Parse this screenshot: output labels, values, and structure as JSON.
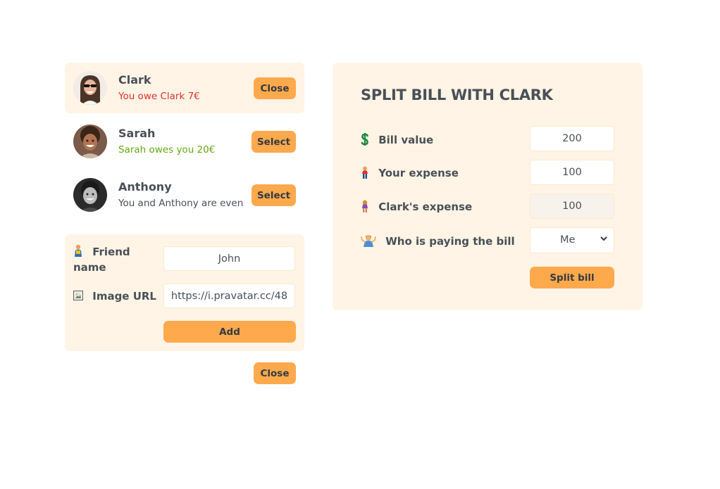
{
  "friends": [
    {
      "name": "Clark",
      "status": "You owe Clark 7€",
      "button": "Close",
      "selected": true
    },
    {
      "name": "Sarah",
      "status": "Sarah owes you 20€",
      "button": "Select",
      "selected": false
    },
    {
      "name": "Anthony",
      "status": "You and Anthony are even",
      "button": "Select",
      "selected": false
    }
  ],
  "add_form": {
    "name_label": "Friend name",
    "name_value": "John",
    "image_label": "Image URL",
    "image_value": "https://i.pravatar.cc/48",
    "add_label": "Add",
    "close_label": "Close"
  },
  "split": {
    "title": "SPLIT BILL WITH CLARK",
    "bill_label": "Bill value",
    "bill_value": "200",
    "expense_label": "Your expense",
    "expense_value": "100",
    "friend_expense_label": "Clark's expense",
    "friend_expense_value": "100",
    "payer_label": "Who is paying the bill",
    "payer_value": "Me",
    "submit_label": "Split bill"
  },
  "colors": {
    "accent": "#ffa94d",
    "panel_bg": "#fff4e6",
    "owe_red": "#e03131",
    "owed_green": "#66a80f"
  }
}
